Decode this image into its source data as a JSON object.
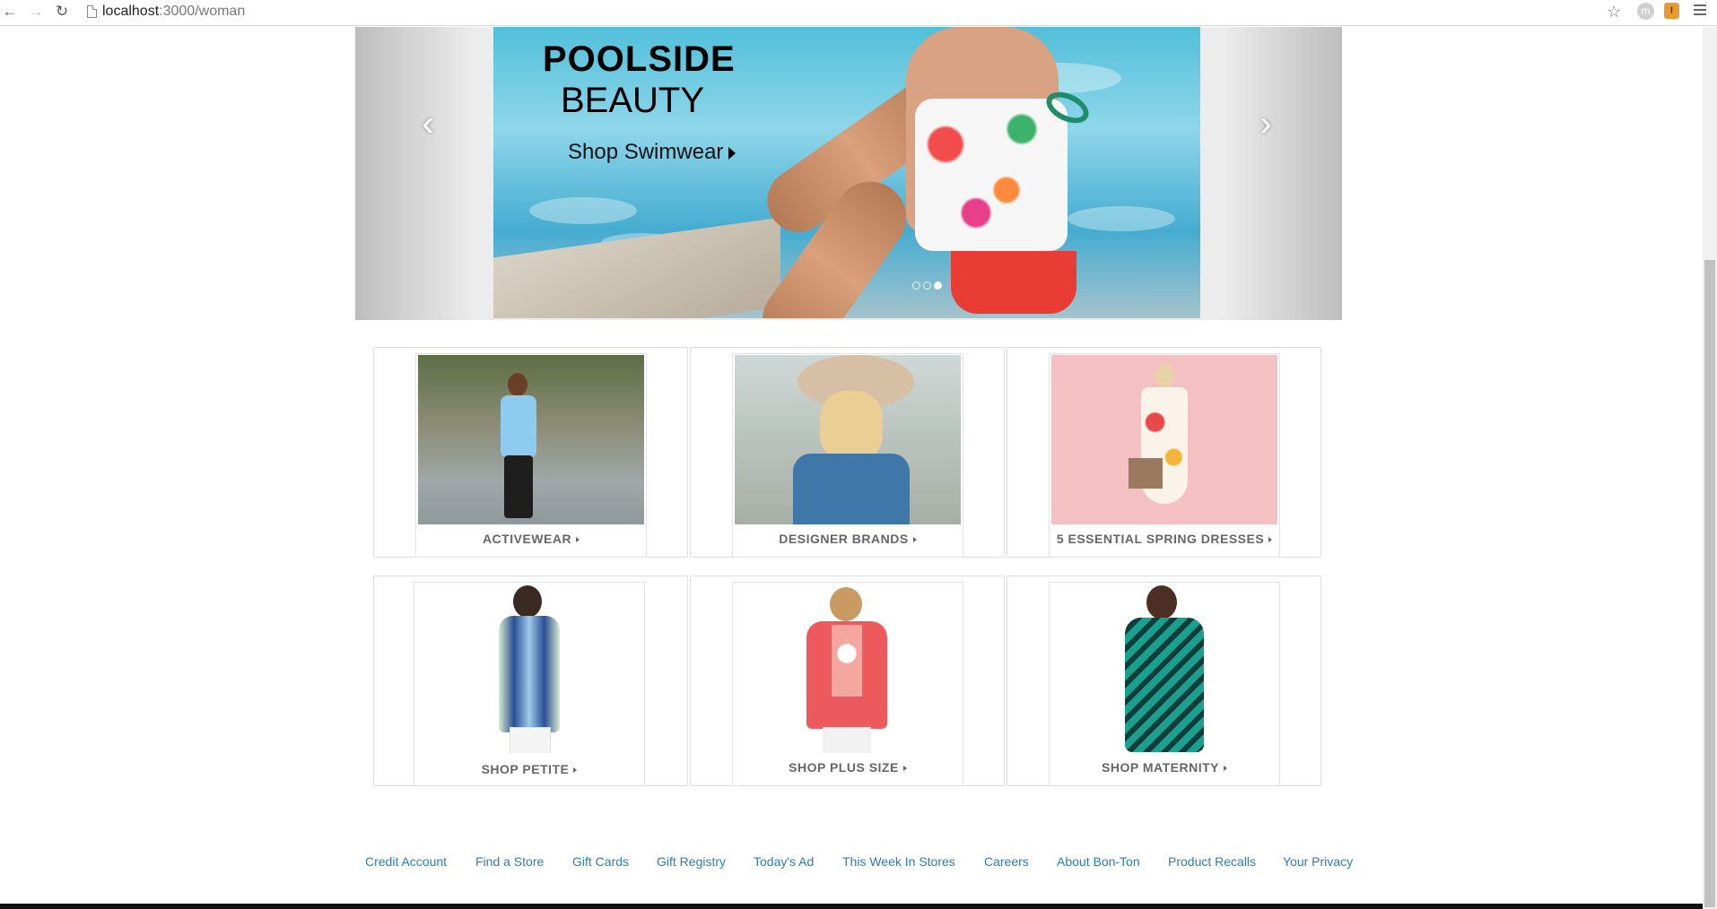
{
  "browser": {
    "url_host": "localhost",
    "url_path": ":3000/woman"
  },
  "hero": {
    "title_line1": "POOLSIDE",
    "title_line2": "BEAUTY",
    "cta": "Shop Swimwear",
    "prev_arrow": "‹",
    "next_arrow": "›",
    "dots": 3,
    "active_dot": 3
  },
  "tiles": [
    {
      "label": "ACTIVEWEAR"
    },
    {
      "label": "DESIGNER BRANDS"
    },
    {
      "label": "5 ESSENTIAL SPRING DRESSES"
    },
    {
      "label": "SHOP PETITE"
    },
    {
      "label": "SHOP PLUS SIZE"
    },
    {
      "label": "SHOP MATERNITY"
    }
  ],
  "footer": {
    "links": [
      "Credit Account",
      "Find a Store",
      "Gift Cards",
      "Gift Registry",
      "Today's Ad",
      "This Week In Stores",
      "Careers",
      "About Bon-Ton",
      "Product Recalls",
      "Your Privacy"
    ]
  },
  "colors": {
    "link": "#2a7cc0",
    "tile_label": "#666666"
  }
}
